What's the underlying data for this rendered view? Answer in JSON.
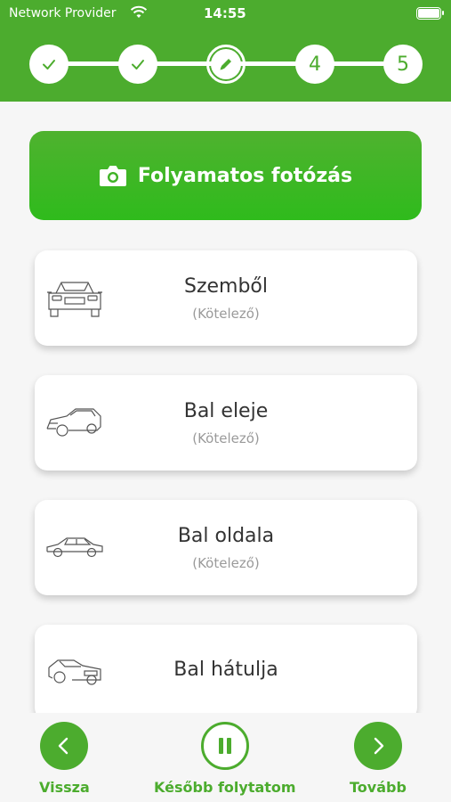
{
  "status": {
    "carrier": "Network Provider",
    "time": "14:55"
  },
  "steps": [
    {
      "state": "done",
      "label": "✓"
    },
    {
      "state": "done",
      "label": "✓"
    },
    {
      "state": "active",
      "label": ""
    },
    {
      "state": "todo",
      "label": "4"
    },
    {
      "state": "todo",
      "label": "5"
    }
  ],
  "main_button": {
    "label": "Folyamatos fotózás"
  },
  "cards": [
    {
      "title": "Szemből",
      "subtitle": "(Kötelező)",
      "icon": "car-front-icon"
    },
    {
      "title": "Bal eleje",
      "subtitle": "(Kötelező)",
      "icon": "car-left-front-icon"
    },
    {
      "title": "Bal oldala",
      "subtitle": "(Kötelező)",
      "icon": "car-left-side-icon"
    },
    {
      "title": "Bal hátulja",
      "subtitle": "",
      "icon": "car-left-rear-icon"
    }
  ],
  "bottom": {
    "back_label": "Vissza",
    "later_label": "Később folytatom",
    "next_label": "Tovább"
  },
  "colors": {
    "accent": "#4cac2e",
    "background": "#f6f6f6"
  }
}
